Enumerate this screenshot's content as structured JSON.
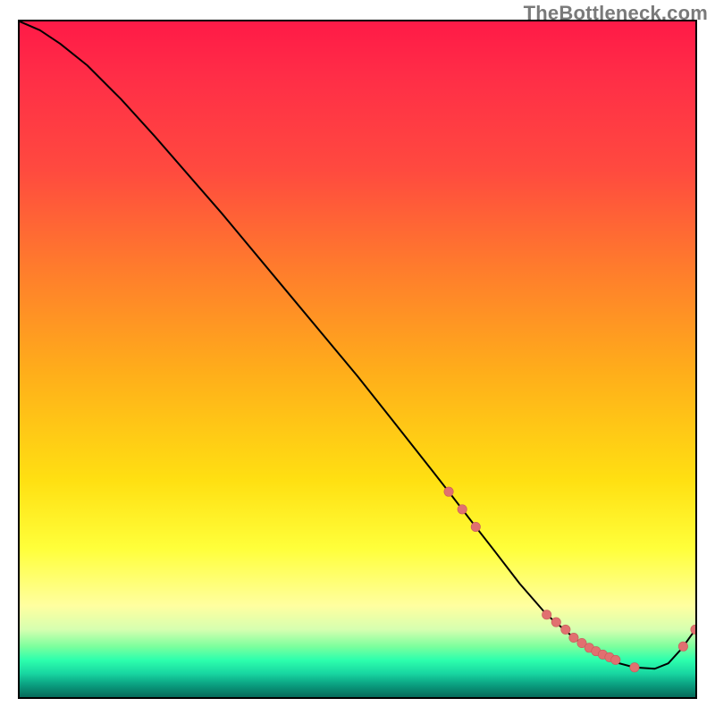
{
  "watermark": "TheBottleneck.com",
  "chart_data": {
    "type": "line",
    "title": "",
    "xlabel": "",
    "ylabel": "",
    "xlim": [
      0,
      100
    ],
    "ylim": [
      0,
      100
    ],
    "grid": false,
    "legend": false,
    "background": {
      "type": "vertical-gradient",
      "stops": [
        {
          "pos": 0,
          "color": "#ff1a47"
        },
        {
          "pos": 0.22,
          "color": "#ff4a3f"
        },
        {
          "pos": 0.52,
          "color": "#ffae1a"
        },
        {
          "pos": 0.78,
          "color": "#ffff3a"
        },
        {
          "pos": 0.9,
          "color": "#d6ffb0"
        },
        {
          "pos": 0.945,
          "color": "#2dffad"
        },
        {
          "pos": 1.0,
          "color": "#066b5a"
        }
      ]
    },
    "series": [
      {
        "name": "bottleneck-curve",
        "x": [
          0,
          3,
          6,
          10,
          15,
          20,
          30,
          40,
          50,
          55,
          58,
          61,
          63.5,
          65.5,
          67.5,
          70,
          74,
          78,
          82,
          85,
          88,
          91,
          94,
          96,
          98,
          100
        ],
        "y": [
          100,
          98.7,
          96.7,
          93.5,
          88.5,
          83,
          71.5,
          59.5,
          47.5,
          41.2,
          37.4,
          33.6,
          30.4,
          27.8,
          25.2,
          22,
          16.8,
          12.2,
          8.8,
          6.6,
          5.2,
          4.4,
          4.2,
          5.0,
          7.2,
          10.0
        ]
      }
    ],
    "markers": {
      "name": "sampled-points",
      "x": [
        63.5,
        65.5,
        67.5,
        78,
        79.4,
        80.8,
        82,
        83.2,
        84.3,
        85.3,
        86.3,
        87.3,
        88.2,
        91,
        98.2,
        100
      ],
      "y": [
        30.4,
        27.8,
        25.2,
        12.2,
        11.1,
        10.0,
        8.8,
        8.0,
        7.3,
        6.8,
        6.3,
        5.9,
        5.5,
        4.4,
        7.5,
        10.0
      ]
    }
  }
}
